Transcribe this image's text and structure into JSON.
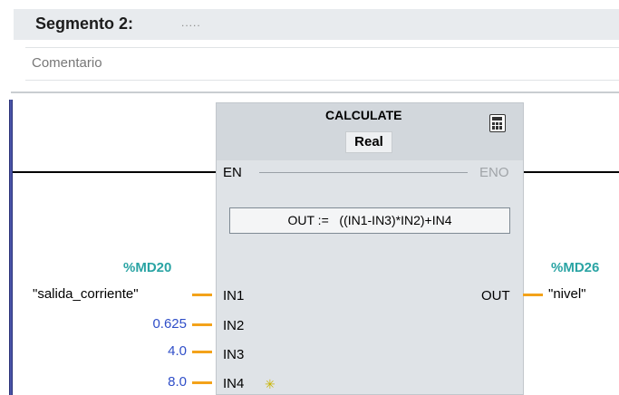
{
  "segment": {
    "title": "Segmento 2:",
    "title_suffix": "....."
  },
  "comment": {
    "text": "Comentario"
  },
  "block": {
    "name": "CALCULATE",
    "data_type": "Real",
    "icon": "calculator-icon",
    "en": "EN",
    "eno": "ENO",
    "formula": "OUT :=   ((IN1-IN3)*IN2)+IN4",
    "inputs": [
      {
        "pin": "IN1",
        "address": "%MD20",
        "tag": "\"salida_corriente\""
      },
      {
        "pin": "IN2",
        "value": "0.625"
      },
      {
        "pin": "IN3",
        "value": "4.0"
      },
      {
        "pin": "IN4",
        "value": "8.0"
      }
    ],
    "output": {
      "pin": "OUT",
      "address": "%MD26",
      "tag": "\"nivel\""
    }
  },
  "colors": {
    "wire": "#f3a21a",
    "address": "#2aa4a4",
    "constant": "#2f4ec8",
    "rail": "#4a54a8"
  }
}
